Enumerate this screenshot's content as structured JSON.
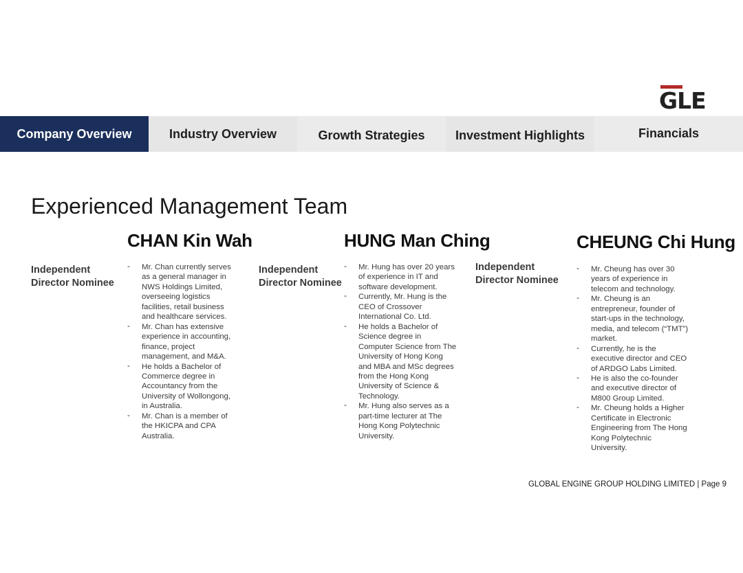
{
  "logo": {
    "text": "GLE"
  },
  "nav": {
    "tabs": [
      {
        "label": "Company Overview"
      },
      {
        "label": "Industry Overview"
      },
      {
        "label": "Growth Strategies"
      },
      {
        "label": "Investment Highlights"
      },
      {
        "label": "Financials"
      }
    ]
  },
  "page": {
    "title": "Experienced Management Team"
  },
  "people": [
    {
      "name": "CHAN Kin Wah",
      "role_line1": "Independent",
      "role_line2": "Director Nominee",
      "bio": [
        [
          "Mr. Chan currently serves",
          "as a general manager in",
          "NWS Holdings Limited,",
          "overseeing logistics",
          "facilities, retail business",
          "and healthcare services."
        ],
        [
          "Mr. Chan has extensive",
          "experience in accounting,",
          "finance, project",
          "management, and M&A."
        ],
        [
          "He holds a Bachelor of",
          "Commerce degree in",
          "Accountancy from the",
          "University of Wollongong,",
          "in Australia."
        ],
        [
          "Mr. Chan is a member of",
          "the HKICPA and CPA",
          "Australia."
        ]
      ]
    },
    {
      "name": "HUNG Man Ching",
      "role_line1": "Independent",
      "role_line2": "Director Nominee",
      "bio": [
        [
          "Mr. Hung has over 20 years",
          "of experience in IT and",
          "software development."
        ],
        [
          "Currently, Mr. Hung is the",
          "CEO of Crossover",
          "International Co. Ltd."
        ],
        [
          "He holds a Bachelor of",
          "Science degree in",
          "Computer Science from The",
          "University of Hong Kong",
          "and MBA and MSc degrees",
          "from the Hong Kong",
          "University of Science &",
          "Technology."
        ],
        [
          "Mr. Hung also serves as a",
          "part-time lecturer at The",
          "Hong Kong Polytechnic",
          "University."
        ]
      ]
    },
    {
      "name": "CHEUNG Chi Hung",
      "role_line1": "Independent",
      "role_line2": "Director Nominee",
      "bio": [
        [
          "Mr. Cheung has over 30",
          "years of experience in",
          "telecom and technology."
        ],
        [
          "Mr. Cheung is an",
          "entrepreneur, founder of",
          "start-ups in the technology,",
          "media, and telecom (“TMT”)",
          "market."
        ],
        [
          "Currently, he is the",
          "executive director and CEO",
          "of ARDGO Labs Limited."
        ],
        [
          "He is also the co-founder",
          "and executive director of",
          "M800 Group Limited."
        ],
        [
          "Mr. Cheung holds a Higher",
          "Certificate in Electronic",
          "Engineering from The Hong",
          "Kong Polytechnic",
          "University."
        ]
      ]
    }
  ],
  "footer": {
    "text": "GLOBAL ENGINE GROUP HOLDING LIMITED | Page 9"
  },
  "colors": {
    "nav_active": "#1b2f5c",
    "nav_inactive": "#e6e6e6",
    "logo_accent": "#b22a2a"
  }
}
